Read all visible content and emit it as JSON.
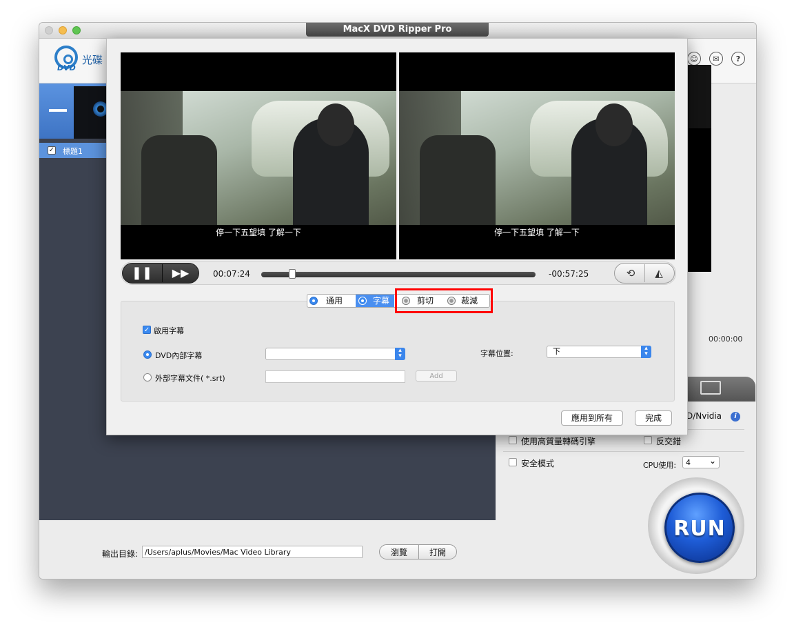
{
  "window": {
    "title": "MacX DVD Ripper Pro"
  },
  "header": {
    "logo_text": "光碟",
    "logo_sub": "DVD"
  },
  "title_list": [
    {
      "label": "標題1",
      "checked": true
    }
  ],
  "right_panel": {
    "time": "00:00:00",
    "gpu_label": "D/Nvidia",
    "options": {
      "high_quality": "使用高質量轉碼引擎",
      "deinterlace": "反交錯",
      "safe_mode": "安全模式",
      "cpu_label": "CPU使用:",
      "cpu_value": "4"
    },
    "run_label": "RUN"
  },
  "output": {
    "label": "輸出目錄:",
    "path": "/Users/aplus/Movies/Mac Video Library",
    "browse": "瀏覽",
    "open": "打開"
  },
  "dialog": {
    "subtitle_text": "停一下五望填 了解一下",
    "player": {
      "current_time": "00:07:24",
      "remaining_time": "-00:57:25",
      "progress": 0.11
    },
    "tabs": [
      {
        "label": "通用",
        "selected": false
      },
      {
        "label": "字幕",
        "selected": true
      },
      {
        "label": "剪切",
        "selected": false
      },
      {
        "label": "裁減",
        "selected": false
      }
    ],
    "subtitle_settings": {
      "enable_label": "啟用字幕",
      "enabled": true,
      "dvd_internal_label": "DVD內部字幕",
      "dvd_internal_selected": true,
      "dvd_internal_value": "",
      "external_label": "外部字幕文件( *.srt)",
      "external_value": "",
      "add_label": "Add",
      "position_label": "字幕位置:",
      "position_value": "下"
    },
    "apply_all_label": "應用到所有",
    "done_label": "完成"
  },
  "colors": {
    "highlight": "#ff0000",
    "accent": "#3b8af0"
  },
  "icons": {
    "user": "user-icon",
    "mail": "mail-icon",
    "help": "help-icon"
  }
}
